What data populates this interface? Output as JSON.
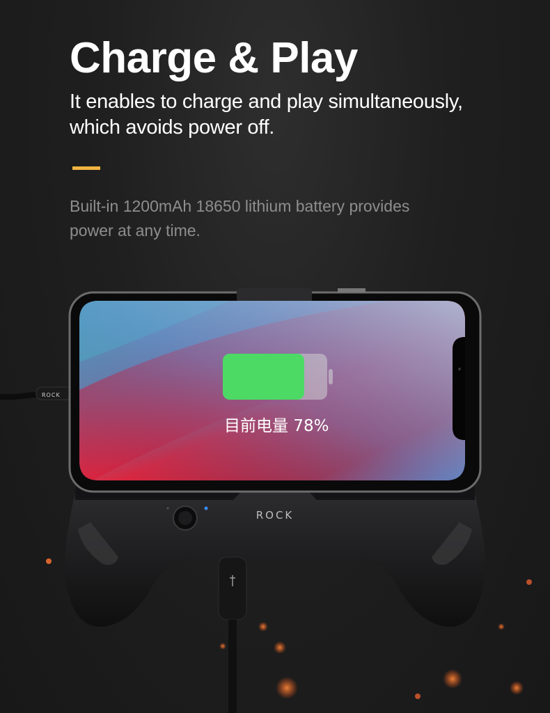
{
  "heading": {
    "title": "Charge & Play",
    "subtitle_line1": "It enables to charge and play simultaneously,",
    "subtitle_line2": "which avoids power off."
  },
  "description": {
    "line1": "Built-in 1200mAh 18650 lithium battery provides",
    "line2": "power at any time."
  },
  "screen": {
    "battery_label": "目前电量 78%",
    "battery_level": 0.78
  },
  "brand": {
    "logo": "ROCK",
    "cable_logo": "ROCK"
  },
  "colors": {
    "accent": "#f2b441",
    "battery_fill": "#4cd964",
    "background": "#1f1f1f"
  }
}
